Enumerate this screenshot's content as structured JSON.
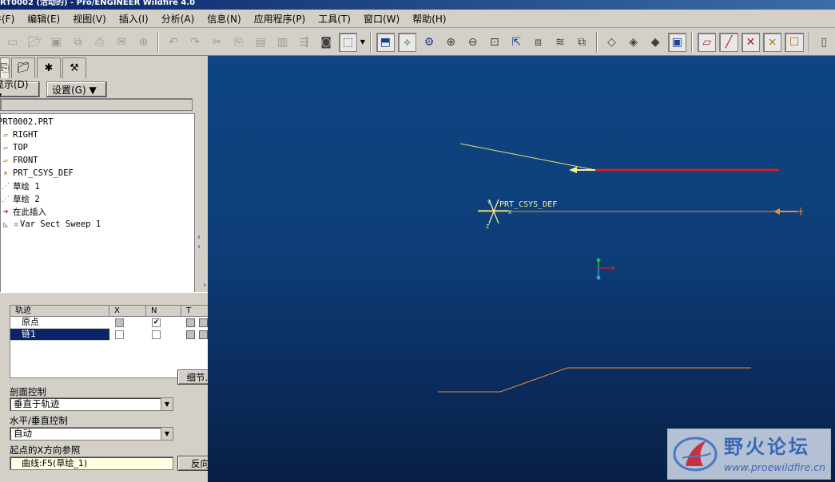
{
  "window": {
    "title": "RT0002 (活动的) - Pro/ENGINEER Wildfire 4.0"
  },
  "menu": [
    {
      "label": "文件(F)"
    },
    {
      "label": "编辑(E)"
    },
    {
      "label": "视图(V)"
    },
    {
      "label": "插入(I)"
    },
    {
      "label": "分析(A)"
    },
    {
      "label": "信息(N)"
    },
    {
      "label": "应用程序(P)"
    },
    {
      "label": "工具(T)"
    },
    {
      "label": "窗口(W)"
    },
    {
      "label": "帮助(H)"
    }
  ],
  "toolbar": {
    "icons": [
      "new-icon",
      "open-icon",
      "save-icon",
      "copy-save-icon",
      "print-icon",
      "email-icon",
      "email-link-icon",
      "undo-icon",
      "redo-icon",
      "cut-icon",
      "copy-icon",
      "paste-icon",
      "paste-special-icon",
      "regenerate-icon",
      "find-icon",
      "select-box-icon",
      "repaint-icon",
      "spin-center-icon",
      "orient-mode-icon",
      "zoom-in-icon",
      "zoom-out-icon",
      "refit-icon",
      "reorient-icon",
      "saved-views-icon",
      "layers-icon",
      "view-manager-icon",
      "wireframe-icon",
      "hidden-line-icon",
      "no-hidden-icon",
      "shading-icon",
      "datum-planes-icon",
      "datum-axes-icon",
      "datum-points-icon",
      "csys-icon",
      "annotations-icon"
    ]
  },
  "model_tree": {
    "view_tabs": [
      {
        "icon": "model-tree-icon"
      },
      {
        "icon": "folder-browser-icon"
      },
      {
        "icon": "favorites-icon"
      },
      {
        "icon": "connections-icon"
      }
    ],
    "show_label": "显示(D) ▼",
    "settings_label": "设置(G) ▼",
    "items": [
      {
        "label": "PRT0002.PRT",
        "icon": "part-icon",
        "indent": 0
      },
      {
        "label": "RIGHT",
        "icon": "datum-plane-icon",
        "indent": 1
      },
      {
        "label": "TOP",
        "icon": "datum-plane-icon",
        "indent": 1
      },
      {
        "label": "FRONT",
        "icon": "datum-plane-icon",
        "indent": 1
      },
      {
        "label": "PRT_CSYS_DEF",
        "icon": "csys-icon",
        "indent": 1
      },
      {
        "label": "草绘 1",
        "icon": "sketch-icon",
        "indent": 1
      },
      {
        "label": "草绘 2",
        "icon": "sketch-icon",
        "indent": 1
      },
      {
        "label": "在此插入",
        "icon": "insert-here-icon",
        "indent": 1
      },
      {
        "label": "Var Sect Sweep 1",
        "icon": "var-sect-sweep-icon",
        "indent": 1
      }
    ]
  },
  "sweep_dialog": {
    "columns": [
      "轨迹",
      "X",
      "N",
      "T"
    ],
    "rows": [
      {
        "name": "原点",
        "x": false,
        "n": true,
        "selected": false
      },
      {
        "name": "链1",
        "x": false,
        "n": false,
        "selected": true
      }
    ],
    "details_button": "细节...",
    "section_control_label": "剖面控制",
    "section_control_value": "垂直于轨迹",
    "hv_control_label": "水平/垂直控制",
    "hv_control_value": "自动",
    "x_ref_label": "起点的X方向参照",
    "x_ref_value": "曲线:F5(草绘_1)",
    "flip_button": "反向"
  },
  "viewport": {
    "csys_label": "PRT_CSYS_DEF",
    "colors": {
      "bg_top": "#0f4584",
      "bg_bottom": "#081f44",
      "trajectory_yellow": "#e8e070",
      "chain_red": "#d0202a",
      "sketch_orange": "#f08a3a",
      "csys_yellow": "#f4f0a0"
    }
  },
  "watermark": {
    "title": "野火论坛",
    "url": "www.proewildfire.cn"
  }
}
